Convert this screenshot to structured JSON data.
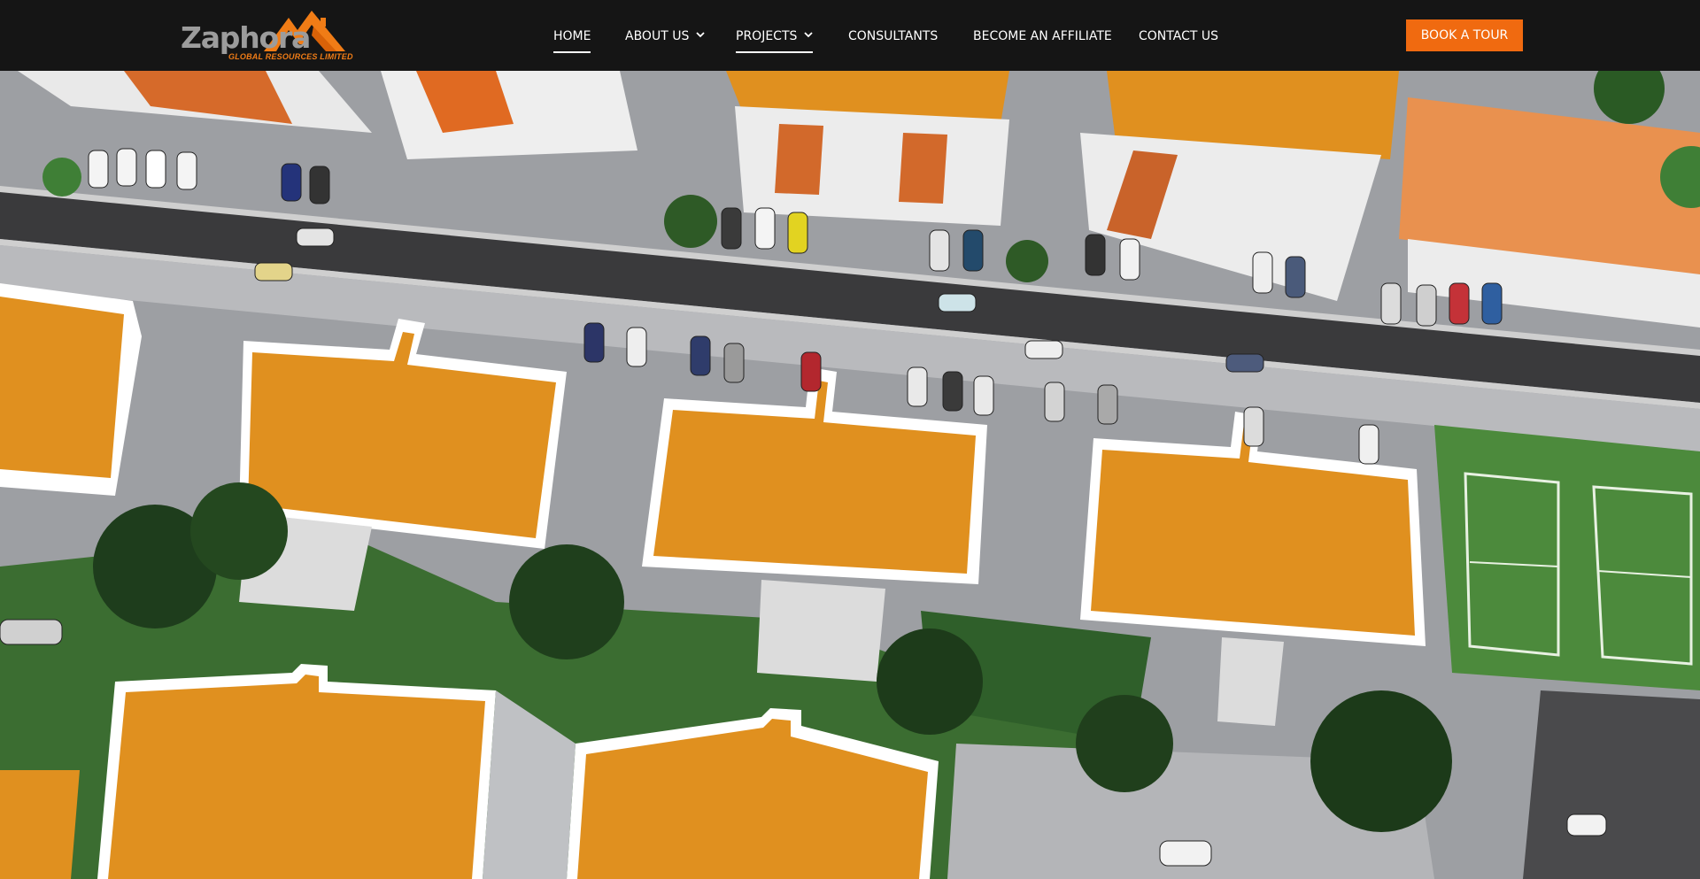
{
  "brand": {
    "name": "Zaphora",
    "subtitle": "GLOBAL RESOURCES LIMITED",
    "accent_color": "#f06a10",
    "header_color": "#151515"
  },
  "nav": {
    "items": [
      {
        "label": "HOME",
        "active": true,
        "dropdown": false
      },
      {
        "label": "ABOUT US",
        "active": false,
        "dropdown": true
      },
      {
        "label": "PROJECTS",
        "active": true,
        "dropdown": true
      },
      {
        "label": "CONSULTANTS",
        "active": false,
        "dropdown": false
      },
      {
        "label": "BECOME AN AFFILIATE",
        "active": false,
        "dropdown": false
      },
      {
        "label": "CONTACT US",
        "active": false,
        "dropdown": false
      }
    ],
    "cta_label": "BOOK A TOUR"
  },
  "hero": {
    "scene": "aerial-estate-render",
    "roof_color": "#e0901f",
    "road_color": "#3a3a3c",
    "lawn_color": "#3f7f36"
  }
}
